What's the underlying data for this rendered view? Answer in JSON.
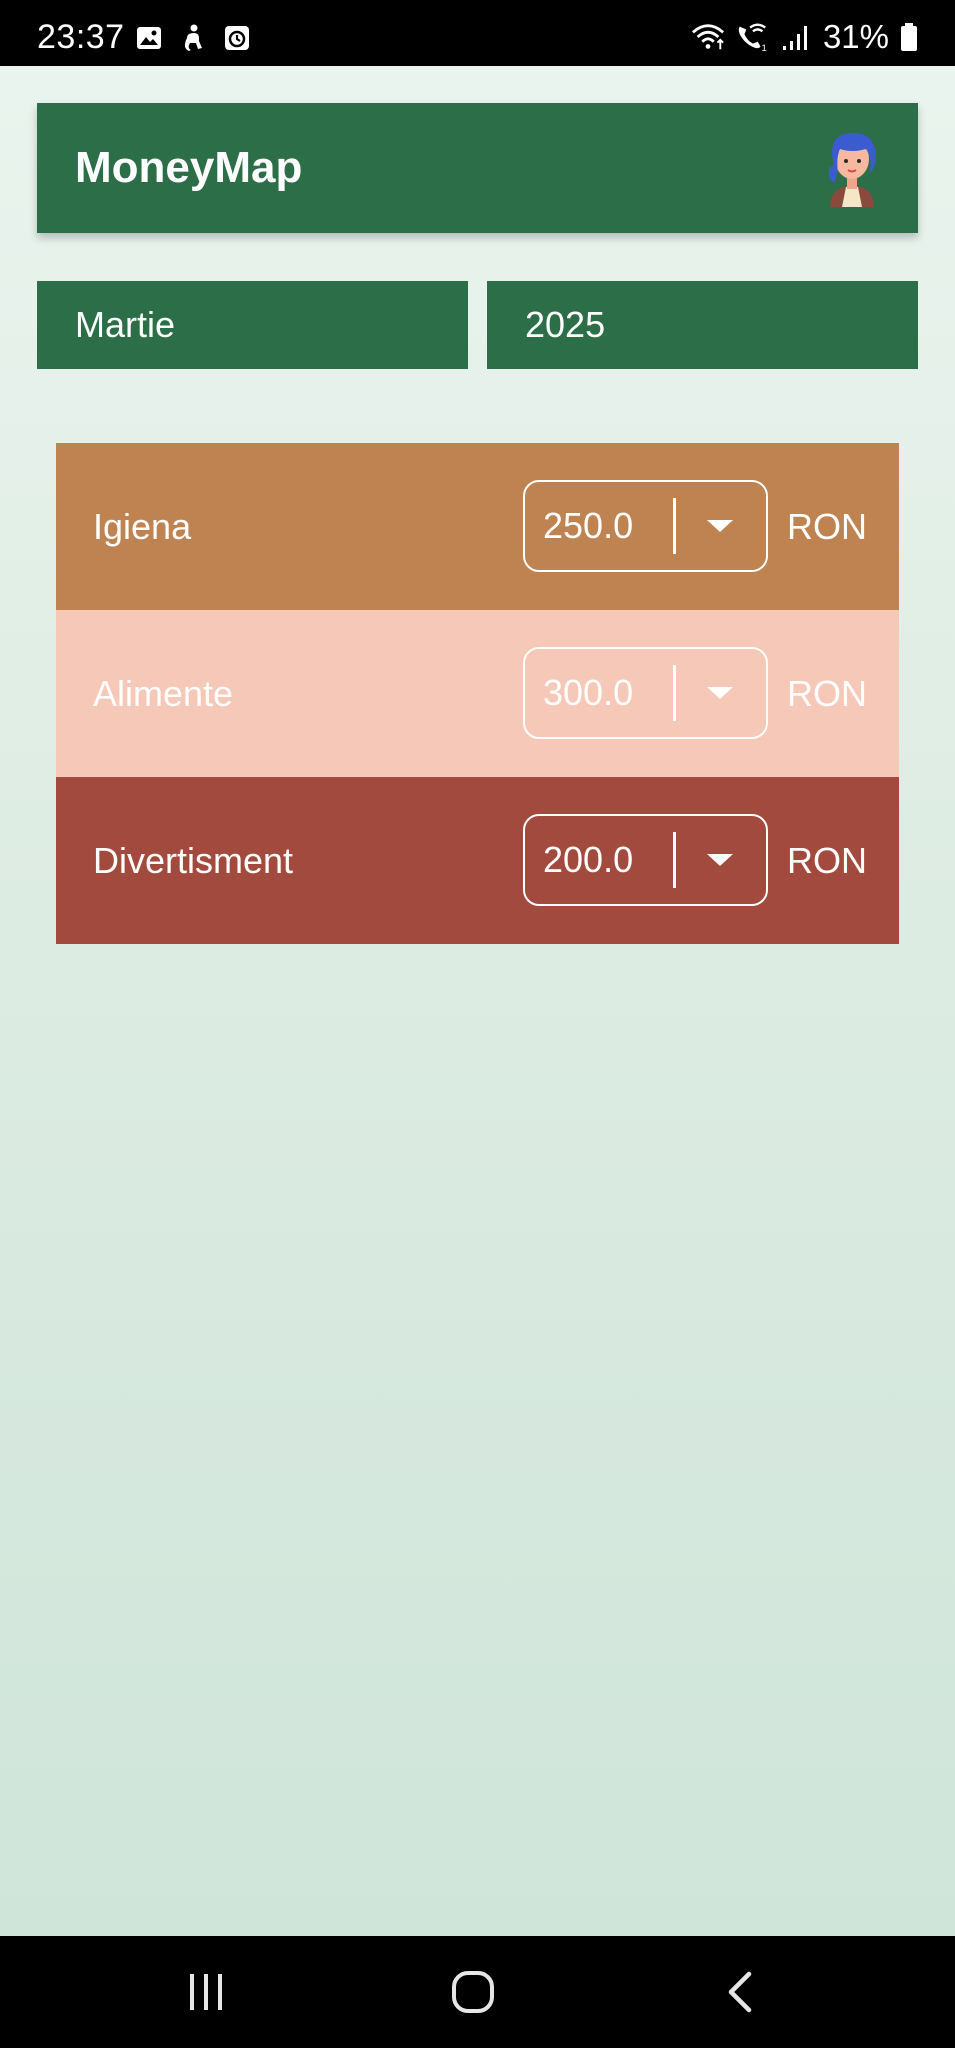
{
  "status_bar": {
    "time": "23:37",
    "battery_percent": "31%",
    "left_icons": [
      "image-icon",
      "accessibility-icon",
      "alarm-app-icon"
    ],
    "right_icons": [
      "wifi-icon",
      "wifi-calling-icon",
      "signal-icon",
      "battery-icon"
    ]
  },
  "app_bar": {
    "title": "MoneyMap",
    "avatar_icon": "user-avatar-icon"
  },
  "selectors": {
    "month": "Martie",
    "year": "2025"
  },
  "budgets": [
    {
      "category": "Igiena",
      "amount": "250.0",
      "currency": "RON",
      "color": "#bf8352"
    },
    {
      "category": "Alimente",
      "amount": "300.0",
      "currency": "RON",
      "color": "#f5c8b7"
    },
    {
      "category": "Divertisment",
      "amount": "200.0",
      "currency": "RON",
      "color": "#a34a3f"
    }
  ],
  "colors": {
    "primary": "#2c6e47",
    "background_top": "#eaf4ee",
    "background_bottom": "#cfe5d9"
  },
  "nav_bar": {
    "buttons": [
      "recents-icon",
      "home-icon",
      "back-icon"
    ]
  }
}
